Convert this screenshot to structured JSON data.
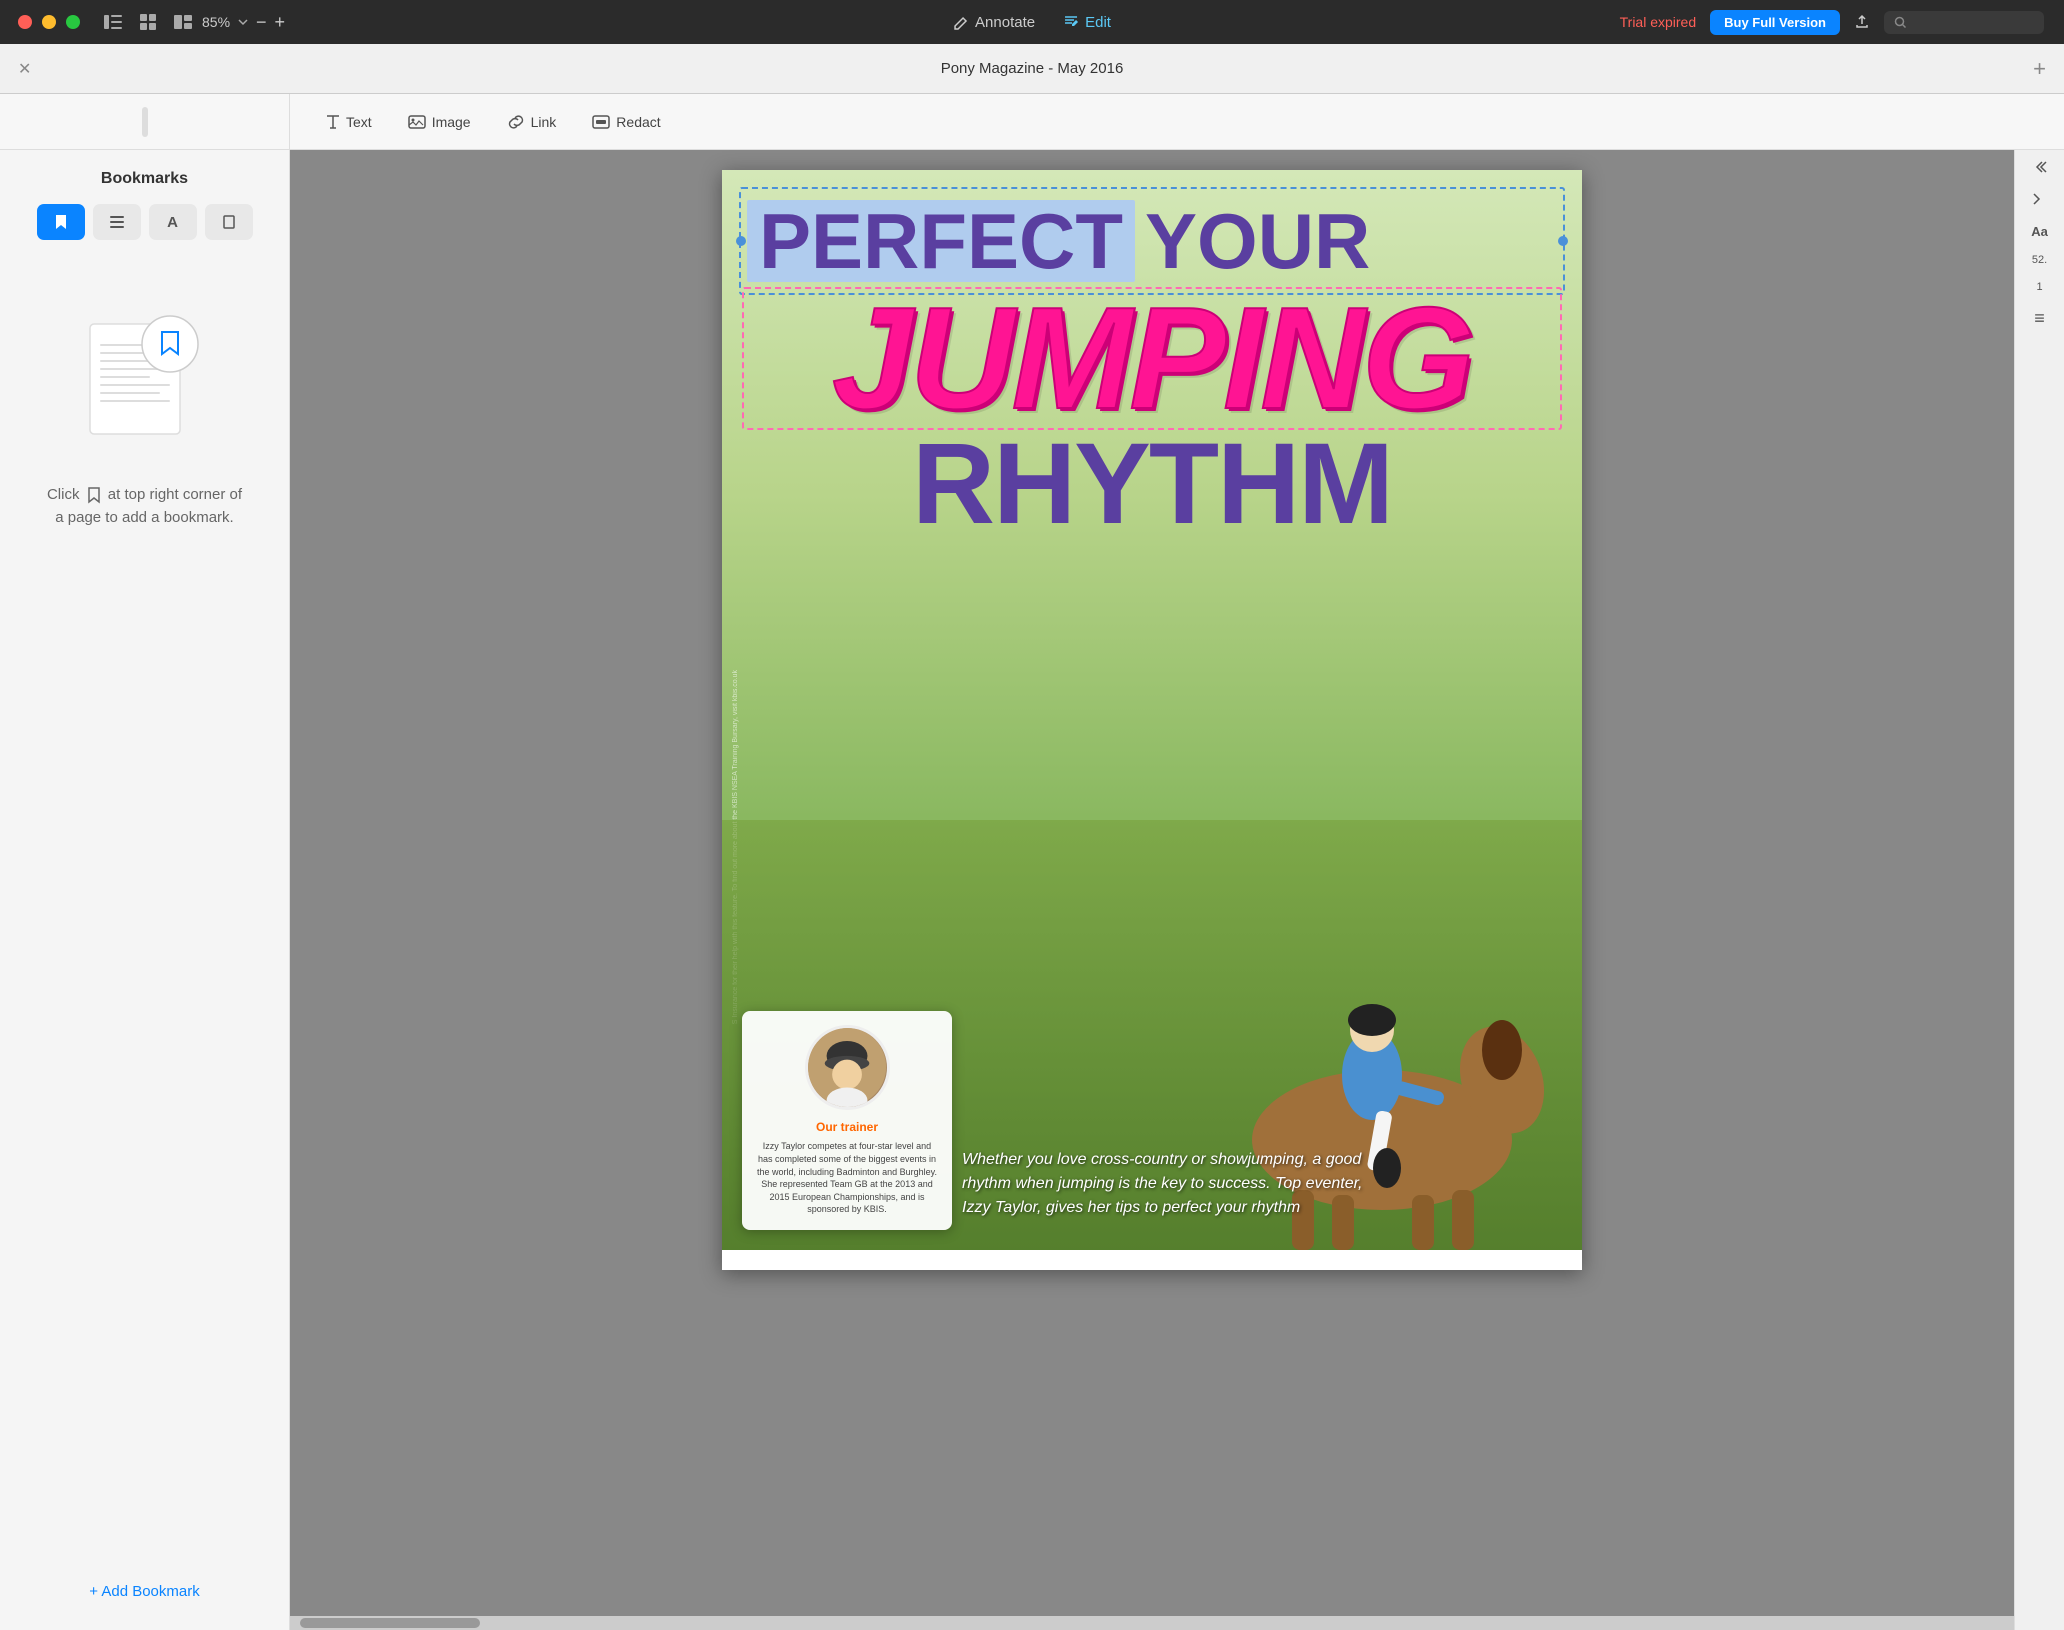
{
  "app": {
    "title": "Pony Magazine - May 2016",
    "traffic_lights": [
      "red",
      "yellow",
      "green"
    ]
  },
  "titlebar": {
    "annotate_label": "Annotate",
    "edit_label": "Edit",
    "trial_expired_label": "Trial expired",
    "buy_btn_label": "Buy Full Version",
    "zoom_value": "85%",
    "search_placeholder": "Search"
  },
  "doc_toolbar": {
    "close_label": "✕",
    "add_label": "+"
  },
  "edit_toolbar": {
    "text_label": "Text",
    "image_label": "Image",
    "link_label": "Link",
    "redact_label": "Redact"
  },
  "sidebar": {
    "title": "Bookmarks",
    "tabs": [
      {
        "id": "bookmark",
        "icon": "🔖",
        "active": true
      },
      {
        "id": "list",
        "icon": "☰",
        "active": false
      },
      {
        "id": "text",
        "icon": "A",
        "active": false
      },
      {
        "id": "page",
        "icon": "□",
        "active": false
      }
    ],
    "empty_hint_line1": "Click",
    "empty_hint_icon": "🔖",
    "empty_hint_line2": "at top right corner of",
    "empty_hint_line3": "a page to add a bookmark.",
    "add_bookmark_label": "+ Add Bookmark"
  },
  "magazine": {
    "headline_perfect": "PERFECT",
    "headline_your": "YOUR",
    "headline_jumping": "JUMPING",
    "headline_rhythm": "RHYTHM",
    "trainer_label": "Our trainer",
    "trainer_name": "Izzy Taylor",
    "trainer_desc": "Izzy Taylor competes at four-star level and has completed some of the biggest events in the world, including Badminton and Burghley. She represented Team GB at the 2013 and 2015 European Championships, and is sponsored by KBIS.",
    "article_text": "Whether you love cross-country or showjumping, a good rhythm when jumping is the key to success. Top eventer, Izzy Taylor, gives her tips to perfect your rhythm",
    "vertical_text": "S Insurance for their help with this feature. To find out more about the KBIS NSEA Training Bursary, visit kbis.co.uk"
  },
  "right_panel": {
    "aa_label": "Aa",
    "size_label": "52.",
    "page_label": "1",
    "menu_icon": "≡"
  },
  "colors": {
    "accent_blue": "#0a84ff",
    "headline_pink": "#ff1493",
    "headline_purple": "#5a3fa0",
    "trainer_orange": "#ff6600",
    "selection_blue": "#4a90d9"
  }
}
